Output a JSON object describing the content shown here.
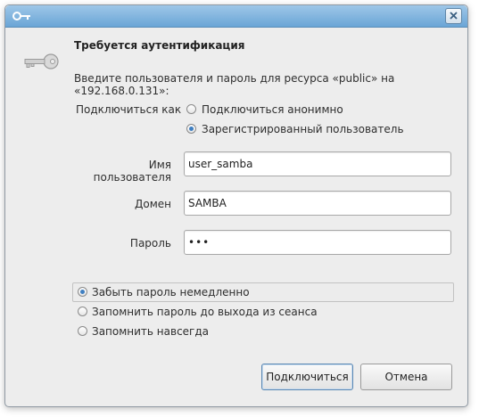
{
  "dialog": {
    "heading": "Требуется аутентификация",
    "description": "Введите пользователя и пароль для ресурса «public» на «192.168.0.131»:",
    "connect_as": {
      "label": "Подключиться как",
      "options": [
        {
          "label": "Подключиться анонимно",
          "selected": false
        },
        {
          "label": "Зарегистрированный пользователь",
          "selected": true
        }
      ]
    },
    "fields": {
      "username": {
        "label": "Имя пользователя",
        "value": "user_samba"
      },
      "domain": {
        "label": "Домен",
        "value": "SAMBA"
      },
      "password": {
        "label": "Пароль",
        "value": "•••"
      }
    },
    "remember": [
      {
        "label": "Забыть пароль немедленно",
        "selected": true
      },
      {
        "label": "Запомнить пароль до выхода из сеанса",
        "selected": false
      },
      {
        "label": "Запомнить навсегда",
        "selected": false
      }
    ],
    "buttons": {
      "connect": "Подключиться",
      "cancel": "Отмена"
    }
  },
  "icons": {
    "title": "key-icon",
    "dialog": "key-icon",
    "close": "close-icon"
  },
  "colors": {
    "titlebar": "#6aa5d6",
    "accent": "#3f7fc1",
    "window_bg": "#ededed"
  }
}
